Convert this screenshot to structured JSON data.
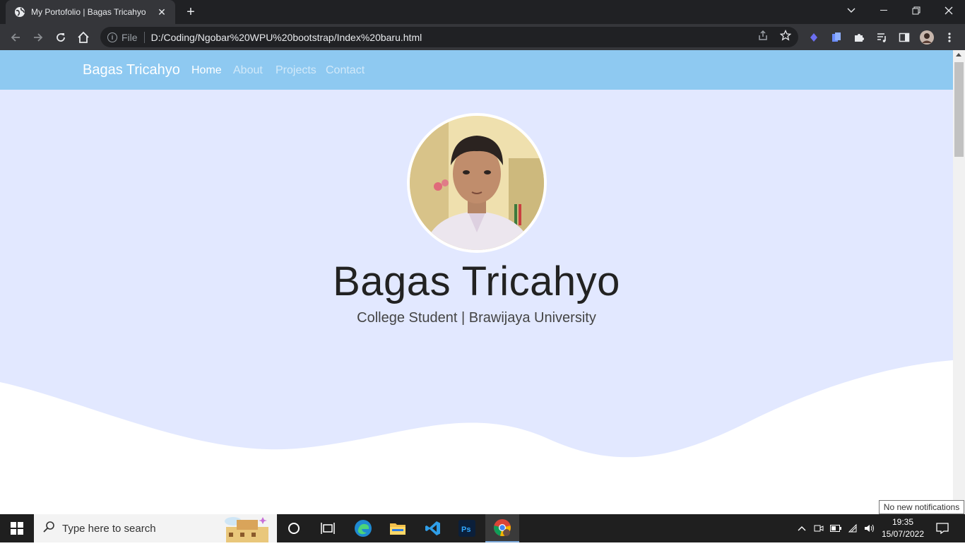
{
  "browser": {
    "tab_title": "My Portofolio | Bagas Tricahyo",
    "new_tab_label": "+",
    "file_label": "File",
    "url": "D:/Coding/Ngobar%20WPU%20bootstrap/Index%20baru.html"
  },
  "navbar": {
    "brand": "Bagas Tricahyo",
    "links": [
      {
        "label": "Home",
        "active": true
      },
      {
        "label": "About",
        "active": false
      },
      {
        "label": "Projects",
        "active": false
      },
      {
        "label": "Contact",
        "active": false
      }
    ],
    "color": "#8ec9f1"
  },
  "hero": {
    "name": "Bagas Tricahyo",
    "subtitle": "College Student | Brawijaya University",
    "background": "#e2e8ff"
  },
  "taskbar": {
    "search_placeholder": "Type here to search",
    "time": "19:35",
    "date": "15/07/2022",
    "notification_tooltip": "No new notifications",
    "apps": [
      "cortana-icon",
      "task-view-icon",
      "edge-icon",
      "file-explorer-icon",
      "vscode-icon",
      "photoshop-icon",
      "chrome-icon"
    ]
  }
}
